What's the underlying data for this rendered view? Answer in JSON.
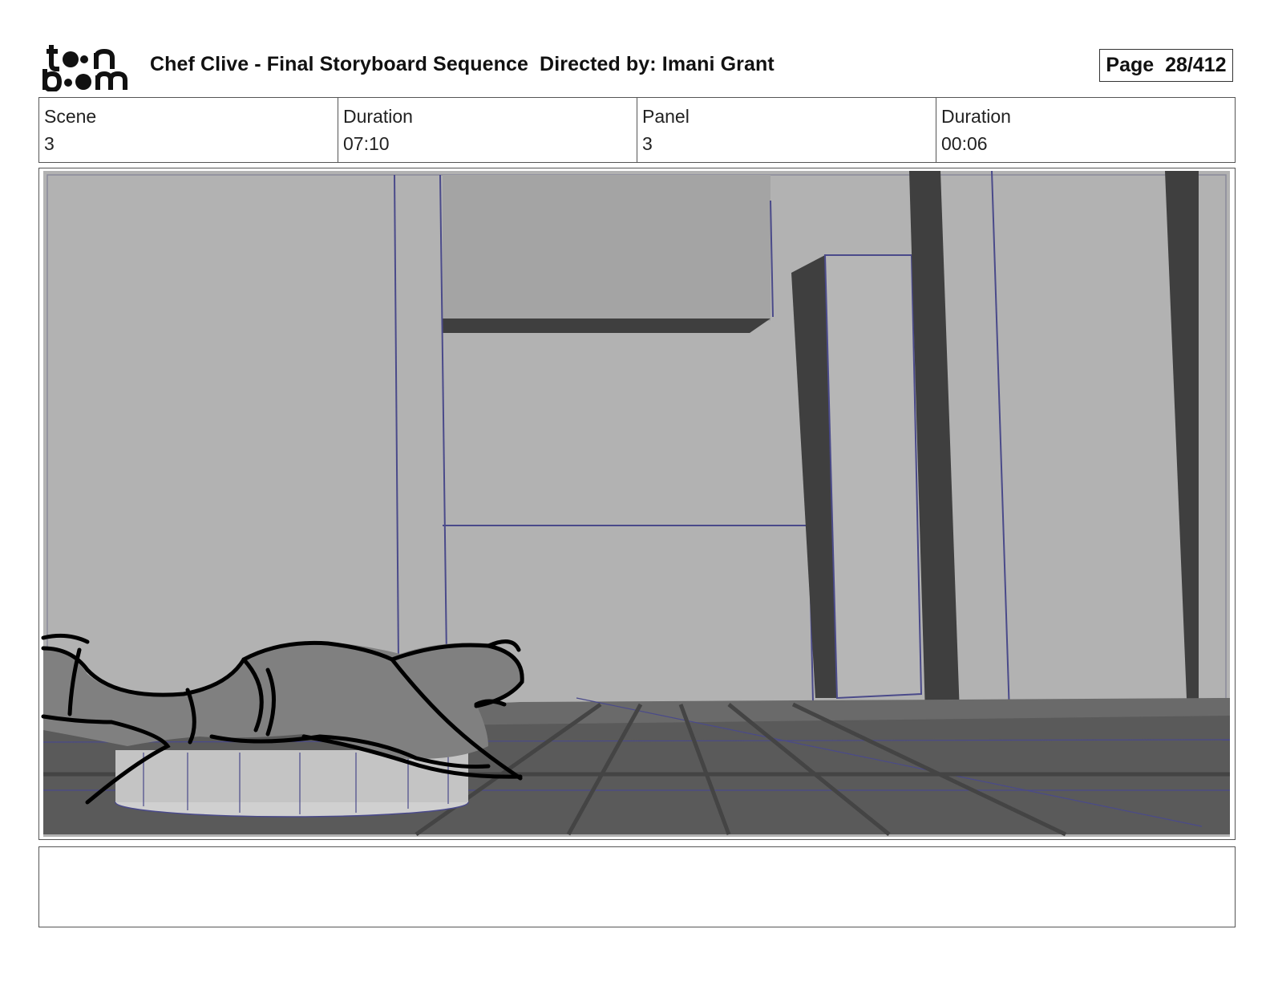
{
  "header": {
    "logo_text_top": "toon",
    "logo_text_bottom": "boom",
    "title": "Chef Clive - Final Storyboard Sequence  Directed by: Imani Grant",
    "page_label": "Page",
    "page_value": "28/412"
  },
  "info": {
    "scene_label": "Scene",
    "scene_value": "3",
    "duration_label": "Duration",
    "duration_value": "07:10",
    "panel_label": "Panel",
    "panel_value": "3",
    "panel_duration_label": "Duration",
    "panel_duration_value": "00:06"
  },
  "notes": {
    "text": ""
  },
  "colors": {
    "wall": "#b2b2b2",
    "dark_pillar": "#3f3f3f",
    "floor": "#5a5a5a",
    "guide_line": "#4a4a8a",
    "ink": "#000000"
  }
}
